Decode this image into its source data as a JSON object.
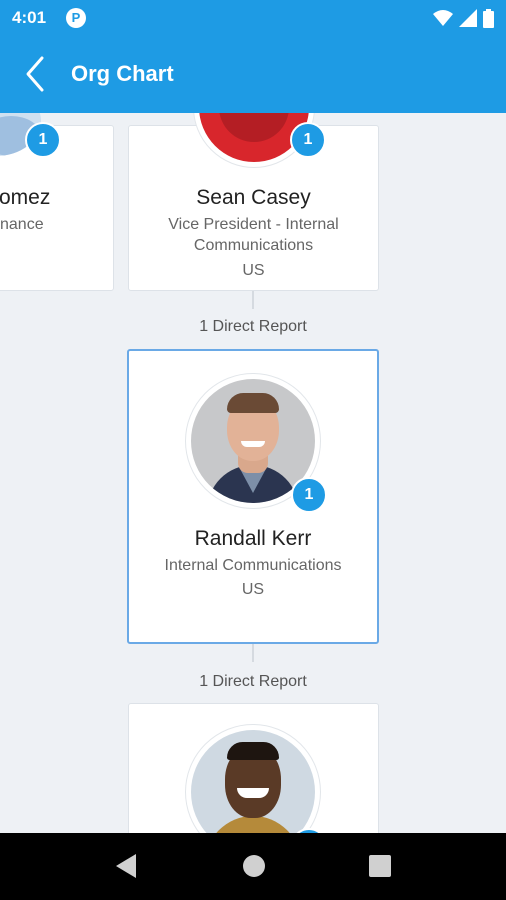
{
  "status_bar": {
    "time": "4:01"
  },
  "app_bar": {
    "title": "Org Chart"
  },
  "org": {
    "left_partial": {
      "name": "omez",
      "role": "nance",
      "badge": "1"
    },
    "sean": {
      "name": "Sean Casey",
      "role_line1": "Vice President - Internal",
      "role_line2": "Communications",
      "location": "US",
      "badge": "1"
    },
    "direct_reports_1": "1 Direct Report",
    "randall": {
      "name": "Randall Kerr",
      "role": "Internal Communications",
      "location": "US",
      "badge": "1"
    },
    "direct_reports_2": "1 Direct Report"
  },
  "colors": {
    "accent": "#1e9be4",
    "selected_border": "#6aa9e6"
  },
  "icons": [
    "back-arrow-icon",
    "wifi-icon",
    "signal-icon",
    "battery-icon",
    "nav-back-icon",
    "nav-home-icon",
    "nav-recents-icon"
  ]
}
